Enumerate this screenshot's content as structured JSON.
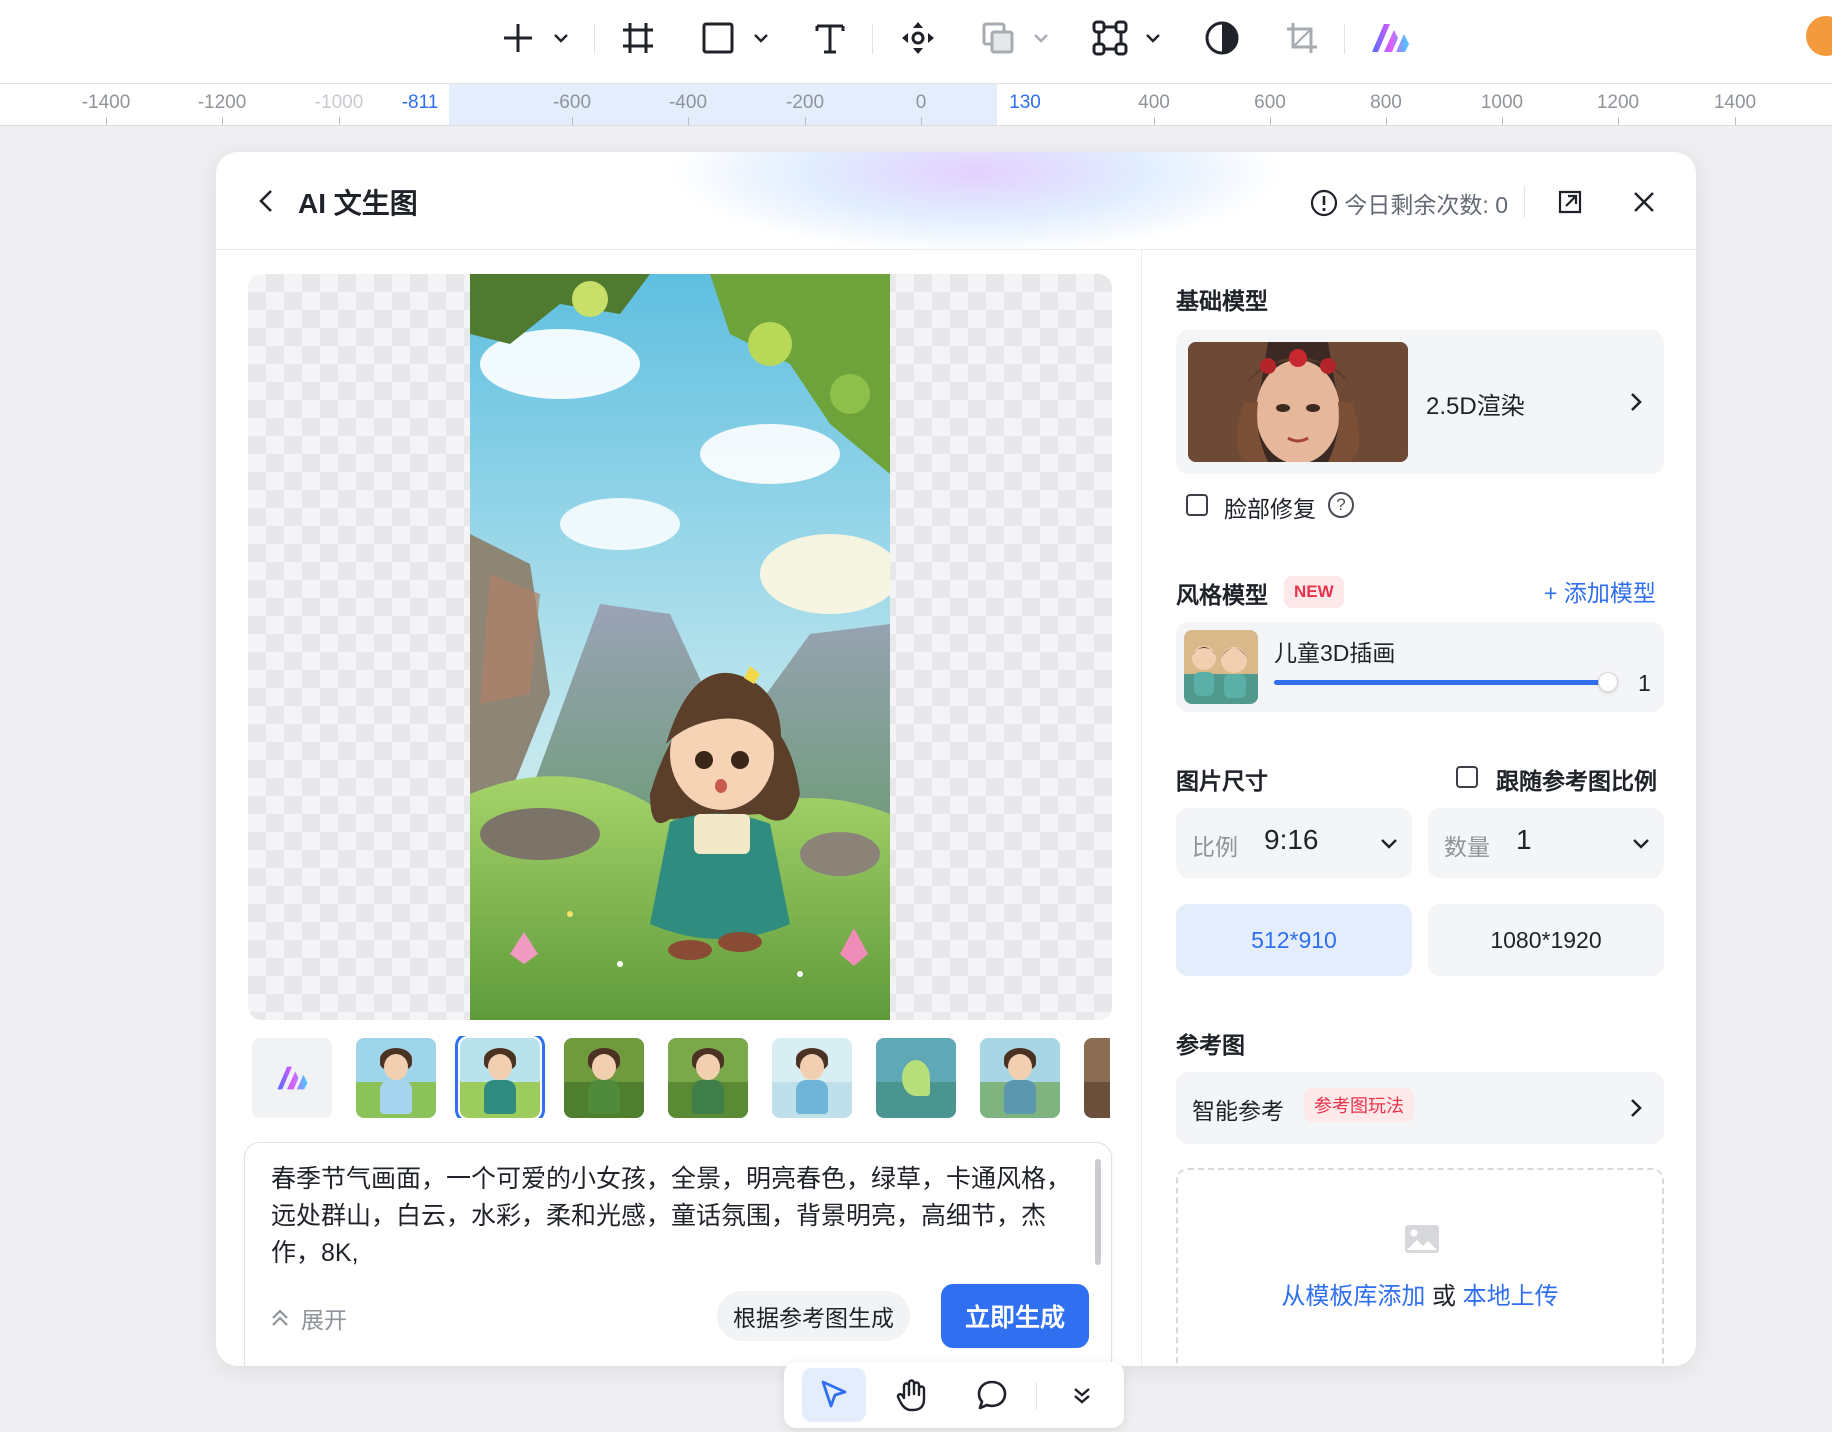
{
  "toolbar": {
    "tools": [
      "add-icon",
      "frame-icon",
      "rectangle-icon",
      "text-icon",
      "move-icon",
      "boolean-icon",
      "vector-icon",
      "mask-icon",
      "crop-icon",
      "ai-logo-icon"
    ]
  },
  "ruler": {
    "ticks": [
      "-1400",
      "-1200",
      "-1000",
      "-811",
      "-600",
      "-400",
      "-200",
      "0",
      "130",
      "400",
      "600",
      "800",
      "1000",
      "1200",
      "1400"
    ],
    "selection_start": "-811",
    "selection_end": "130"
  },
  "modal": {
    "title": "AI 文生图",
    "quota_label": "今日剩余次数: 0",
    "prompt": {
      "text": "春季节气画面，一个可爱的小女孩，全景，明亮春色，绿草，卡通风格，远处群山，白云，水彩，柔和光感，童话氛围，背景明亮，高细节，杰作，8K,",
      "expand_label": "展开",
      "ref_generate_label": "根据参考图生成",
      "generate_label": "立即生成"
    },
    "right_panel": {
      "base_model_label": "基础模型",
      "base_model_name": "2.5D渲染",
      "face_fix_label": "脸部修复",
      "style_model_label": "风格模型",
      "new_badge": "NEW",
      "add_model_label": "+ 添加模型",
      "style_name": "儿童3D插画",
      "style_weight": "1",
      "style_weight_fraction": 1,
      "size_label": "图片尺寸",
      "follow_ref_label": "跟随参考图比例",
      "ratio_label": "比例",
      "ratio_value": "9:16",
      "count_label": "数量",
      "count_value": "1",
      "size_options": [
        "512*910",
        "1080*1920"
      ],
      "selected_size": "512*910",
      "ref_image_label": "参考图",
      "smart_ref_label": "智能参考",
      "ref_play_badge": "参考图玩法",
      "upload_from_template": "从模板库添加",
      "upload_or": "或",
      "upload_local": "本地上传"
    }
  },
  "bottom_toolbar": {
    "tools": [
      "pointer-icon",
      "hand-icon",
      "comment-icon",
      "more-icon"
    ],
    "active": "pointer-icon"
  },
  "colors": {
    "accent": "#2f6ff0",
    "badge_red": "#e8334a"
  }
}
